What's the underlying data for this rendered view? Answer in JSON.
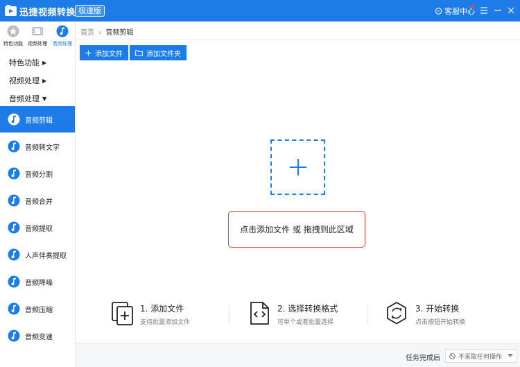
{
  "titlebar": {
    "app_name": "迅捷视频转换器",
    "badge": "极速版",
    "service": "客服中心"
  },
  "top_tabs": [
    {
      "label": "特色功能"
    },
    {
      "label": "视频处理"
    },
    {
      "label": "音频处理"
    }
  ],
  "categories": [
    {
      "label": "特色功能",
      "arrow": "▶"
    },
    {
      "label": "视频处理",
      "arrow": "▶"
    },
    {
      "label": "音频处理",
      "arrow": "▼"
    }
  ],
  "nav_items": [
    {
      "label": "音频剪辑",
      "active": true
    },
    {
      "label": "音频转文字"
    },
    {
      "label": "音频分割"
    },
    {
      "label": "音频合并"
    },
    {
      "label": "音频提取"
    },
    {
      "label": "人声伴奏提取"
    },
    {
      "label": "音频降噪"
    },
    {
      "label": "音频压缩"
    },
    {
      "label": "音频变速"
    }
  ],
  "breadcrumb": {
    "home": "首页",
    "sep": "›",
    "current": "音频剪辑"
  },
  "toolbar": {
    "add_file": "添加文件",
    "add_folder": "添加文件夹"
  },
  "dropzone": {
    "hint": "点击添加文件 或 拖拽到此区域"
  },
  "steps": [
    {
      "title": "1. 添加文件",
      "desc": "支持批量添加文件"
    },
    {
      "title": "2. 选择转换格式",
      "desc": "可单个或者批量选择"
    },
    {
      "title": "3. 开始转换",
      "desc": "点击按钮开始转换"
    }
  ],
  "footer": {
    "task_label": "任务完成后",
    "select_value": "不采取任何操作"
  },
  "colors": {
    "accent": "#1d7ce8",
    "highlight_border": "#e5483a"
  }
}
